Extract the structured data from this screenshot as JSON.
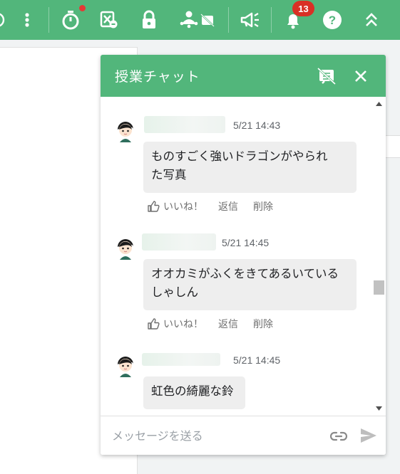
{
  "colors": {
    "brand": "#52b67b",
    "badge": "#d93025",
    "bubble": "#eeeeee"
  },
  "toolbar": {
    "icons": [
      "partial-circle-icon",
      "more-vert-icon",
      "timer-icon",
      "hide-video-icon",
      "lock-icon",
      "presenter-chat-off-icon",
      "megaphone-icon",
      "bell-icon",
      "help-icon",
      "collapse-up-icon"
    ],
    "notification_count": "13"
  },
  "chat": {
    "title": "授業チャット",
    "messages": [
      {
        "time": "5/21 14:43",
        "text_lines": [
          "ものすごく強いドラゴンがやられ",
          "た写真"
        ],
        "like_label": "いいね！",
        "reply_label": "返信",
        "delete_label": "削除"
      },
      {
        "time": "5/21 14:45",
        "text_lines": [
          "オオカミがふくをきてあるいている",
          "しゃしん"
        ],
        "like_label": "いいね！",
        "reply_label": "返信",
        "delete_label": "削除"
      },
      {
        "time": "5/21 14:45",
        "text_lines": [
          "虹色の綺麗な鈴"
        ]
      }
    ],
    "input": {
      "placeholder": "メッセージを送る",
      "value": ""
    }
  }
}
